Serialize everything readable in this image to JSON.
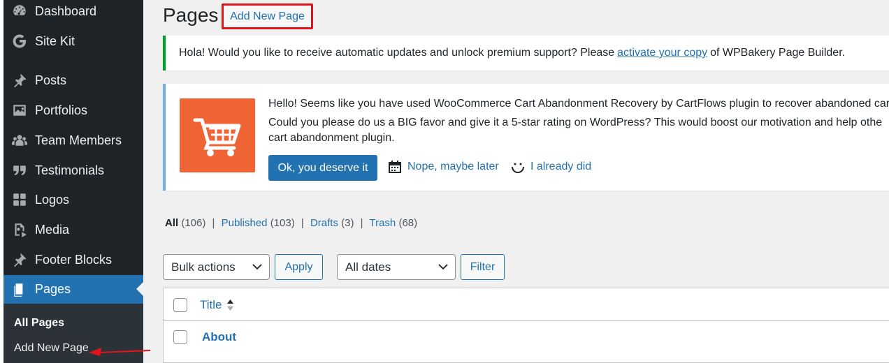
{
  "sidebar": {
    "items": [
      {
        "label": "Dashboard",
        "icon": "dashboard-icon"
      },
      {
        "label": "Site Kit",
        "icon": "google-g-icon"
      },
      {
        "label": "Posts",
        "icon": "pushpin-icon"
      },
      {
        "label": "Portfolios",
        "icon": "image-icon"
      },
      {
        "label": "Team Members",
        "icon": "groups-icon"
      },
      {
        "label": "Testimonials",
        "icon": "quote-icon"
      },
      {
        "label": "Logos",
        "icon": "grid-icon"
      },
      {
        "label": "Media",
        "icon": "media-icon"
      },
      {
        "label": "Footer Blocks",
        "icon": "pushpin-icon"
      },
      {
        "label": "Pages",
        "icon": "pages-icon"
      }
    ],
    "submenu": {
      "all_pages": "All Pages",
      "add_new": "Add New Page"
    }
  },
  "header": {
    "title": "Pages",
    "add_new_button": "Add New Page"
  },
  "notice_wpbakery": {
    "text_before": "Hola! Would you like to receive automatic updates and unlock premium support? Please",
    "link": "activate your copy",
    "text_after": "of WPBakery Page Builder."
  },
  "notice_cartflows": {
    "line1": "Hello! Seems like you have used WooCommerce Cart Abandonment Recovery by CartFlows plugin to recover abandoned car",
    "line2": "Could you please do us a BIG favor and give it a 5-star rating on WordPress? This would boost our motivation and help othe",
    "line3": "cart abandonment plugin.",
    "ok_button": "Ok, you deserve it",
    "later_link": "Nope, maybe later",
    "did_link": "I already did"
  },
  "filters": {
    "all": "All",
    "all_count": "(106)",
    "published": "Published",
    "published_count": "(103)",
    "drafts": "Drafts",
    "drafts_count": "(3)",
    "trash": "Trash",
    "trash_count": "(68)",
    "separator": "|"
  },
  "tablenav": {
    "bulk_actions": "Bulk actions",
    "apply": "Apply",
    "all_dates": "All dates",
    "filter": "Filter"
  },
  "table": {
    "title_column": "Title",
    "rows": [
      {
        "title": "About"
      }
    ]
  },
  "colors": {
    "sidebar_bg": "#1d2327",
    "accent": "#2271b1",
    "highlight_border": "#e3131b",
    "success": "#00a32a",
    "info": "#72aee6",
    "cart_logo": "#f06335"
  }
}
